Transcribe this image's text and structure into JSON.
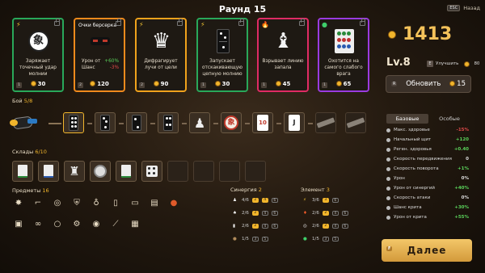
{
  "header": {
    "round_title": "Раунд 15",
    "back_key": "ESC",
    "back_label": "Назад"
  },
  "shop": {
    "cards": [
      {
        "title": "",
        "desc": "Заряжает точечный удар молнии",
        "price": "30",
        "color": "#29a85a",
        "art": "mahjong-tile-icon"
      },
      {
        "title": "Очки берсерка",
        "desc_lines": [
          "Урон от",
          "Шанс"
        ],
        "bonus": [
          "+60%",
          "-3%"
        ],
        "price": "120",
        "color": "#f08a1c",
        "art": "sunglasses-icon"
      },
      {
        "title": "",
        "desc": "Дифрагирует лучи от цели",
        "price": "90",
        "color": "#f0a21c",
        "art": "chess-queen-icon"
      },
      {
        "title": "",
        "desc": "Запускает отскакивающую цепную молнию",
        "price": "30",
        "color": "#29a85a",
        "art": "domino-icon"
      },
      {
        "title": "",
        "desc": "Взрывает линию запала",
        "price": "45",
        "color": "#e02b64",
        "art": "chess-bishop-icon"
      },
      {
        "title": "",
        "desc": "Охотится на самого слабого врага",
        "price": "65",
        "color": "#9a3be0",
        "art": "mahjong-dots-icon"
      }
    ]
  },
  "player": {
    "gold": "1413",
    "level": "Lv.8",
    "upgrade_label": "Улучшить",
    "upgrade_price": "80",
    "reroll_label": "Обновить",
    "reroll_price": "15",
    "reroll_key": "R"
  },
  "fight": {
    "label": "Бой",
    "count": "5/8"
  },
  "inventory": {
    "label": "Склады",
    "count": "6/10"
  },
  "items": {
    "label": "Предметы",
    "count": "16"
  },
  "synergy": {
    "label": "Синергия",
    "count": "2",
    "rows": [
      {
        "value": "4/6",
        "levels": [
          "2",
          "4",
          "6"
        ],
        "active": 2
      },
      {
        "value": "2/6",
        "levels": [
          "2",
          "4",
          "6"
        ],
        "active": 1
      },
      {
        "value": "2/6",
        "levels": [
          "2",
          "4",
          "6"
        ],
        "active": 1
      },
      {
        "value": "1/5",
        "levels": [
          "3",
          "5"
        ],
        "active": 0
      }
    ]
  },
  "element": {
    "label": "Элемент",
    "count": "3",
    "rows": [
      {
        "value": "3/6",
        "levels": [
          "3",
          "6"
        ],
        "active": 1
      },
      {
        "value": "2/6",
        "levels": [
          "2",
          "4",
          "6"
        ],
        "active": 1
      },
      {
        "value": "2/6",
        "levels": [
          "2",
          "4",
          "6"
        ],
        "active": 1
      },
      {
        "value": "1/5",
        "levels": [
          "3",
          "5"
        ],
        "active": 0
      }
    ]
  },
  "tabs": {
    "base": "Базовые",
    "special": "Особые"
  },
  "stats": [
    {
      "label": "Макс. здоровье",
      "value": "-15%",
      "color": "#e04a4a"
    },
    {
      "label": "Начальный щит",
      "value": "+120",
      "color": "#5ad15a"
    },
    {
      "label": "Реген. здоровья",
      "value": "+0.40",
      "color": "#5ad15a"
    },
    {
      "label": "Скорость передвижения",
      "value": "0",
      "color": "#dddddd"
    },
    {
      "label": "Скорость поворота",
      "value": "+1%",
      "color": "#5ad15a"
    },
    {
      "label": "Урон",
      "value": "0%",
      "color": "#dddddd"
    },
    {
      "label": "Урон от синергий",
      "value": "+40%",
      "color": "#5ad15a"
    },
    {
      "label": "Скорость атаки",
      "value": "0%",
      "color": "#dddddd"
    },
    {
      "label": "Шанс крита",
      "value": "+30%",
      "color": "#5ad15a"
    },
    {
      "label": "Урон от крита",
      "value": "+55%",
      "color": "#5ad15a"
    }
  ],
  "next_button": {
    "label": "Далее",
    "key": "F"
  }
}
